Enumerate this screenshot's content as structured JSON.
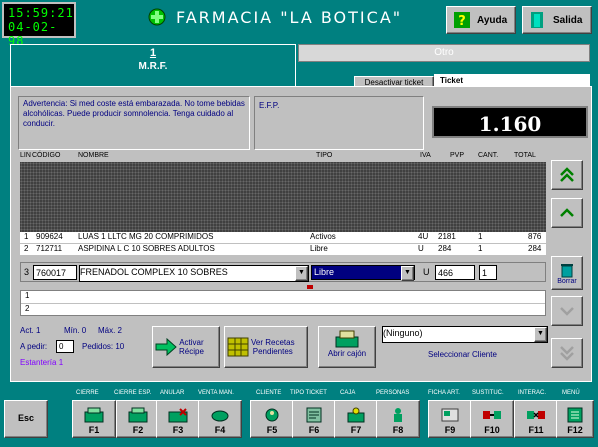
{
  "clock": {
    "time": "15:59:21",
    "date": "04-02-98"
  },
  "app_title": "FARMACIA \"LA BOTICA\"",
  "top_buttons": {
    "help": "Ayuda",
    "exit": "Salida"
  },
  "tabs": [
    {
      "number": "1",
      "label": "M.R.F."
    },
    {
      "label": "Otro"
    }
  ],
  "subtabs": {
    "deactivate": "Desactivar ticket",
    "ticket": "Ticket"
  },
  "warning_text": "Advertencia: Si med coste está embarazada. No tome bebidas alcohólicas. Puede producir somnolencia. Tenga cuidado al conducir.",
  "efp_label": "E.F.P.",
  "total_display": "1.160",
  "columns": [
    "LIN",
    "CÓDIGO",
    "NOMBRE",
    "TIPO",
    "IVA",
    "PVP",
    "CANT.",
    "TOTAL"
  ],
  "rows": [
    {
      "lin": "1",
      "code": "909624",
      "name": "LUAS 1 LLTC MG 20 COMPRIMIDOS",
      "type": "Activos",
      "iva": "4U",
      "pvp": "2181",
      "qty": "1",
      "total": "876"
    },
    {
      "lin": "2",
      "code": "712711",
      "name": "ASPIDINA L C 10 SOBRES ADULTOS",
      "type": "Libre",
      "iva": "U",
      "pvp": "284",
      "qty": "1",
      "total": "284"
    }
  ],
  "edit_row": {
    "lin": "3",
    "code": "760017",
    "name": "FRENADOL COMPLEX 10 SOBRES",
    "type": "Libre",
    "iva": "U",
    "pvp": "466",
    "qty": "1"
  },
  "empty_rows": [
    "1",
    "2"
  ],
  "info": {
    "act": "Act. 1",
    "min": "Mín. 0",
    "max": "Máx. 2",
    "to_order_label": "A pedir:",
    "to_order": "0",
    "orders_label": "Pedidos: 10",
    "shelf": "Estantería 1"
  },
  "action_buttons": {
    "activate_recipe": "Activar\nRécipe",
    "view_pending": "Ver Recetas\nPendientes",
    "open_drawer": "Abrir cajón"
  },
  "client": {
    "value": "(Ninguno)",
    "select_label": "Seleccionar Cliente"
  },
  "side_buttons": {
    "delete": "Borrar"
  },
  "fkey_labels": [
    "CIERRE",
    "CIERRE ESP.",
    "ANULAR",
    "VENTA MAN.",
    "CLIENTE",
    "TIPO TICKET",
    "CAJA",
    "PERSONAS",
    "FICHA ART.",
    "SUSTITUC.",
    "INTERAC.",
    "MENÚ"
  ],
  "fkeys": [
    "Esc",
    "F1",
    "F2",
    "F3",
    "F4",
    "F5",
    "F6",
    "F7",
    "F8",
    "F9",
    "F10",
    "F11",
    "F12"
  ]
}
